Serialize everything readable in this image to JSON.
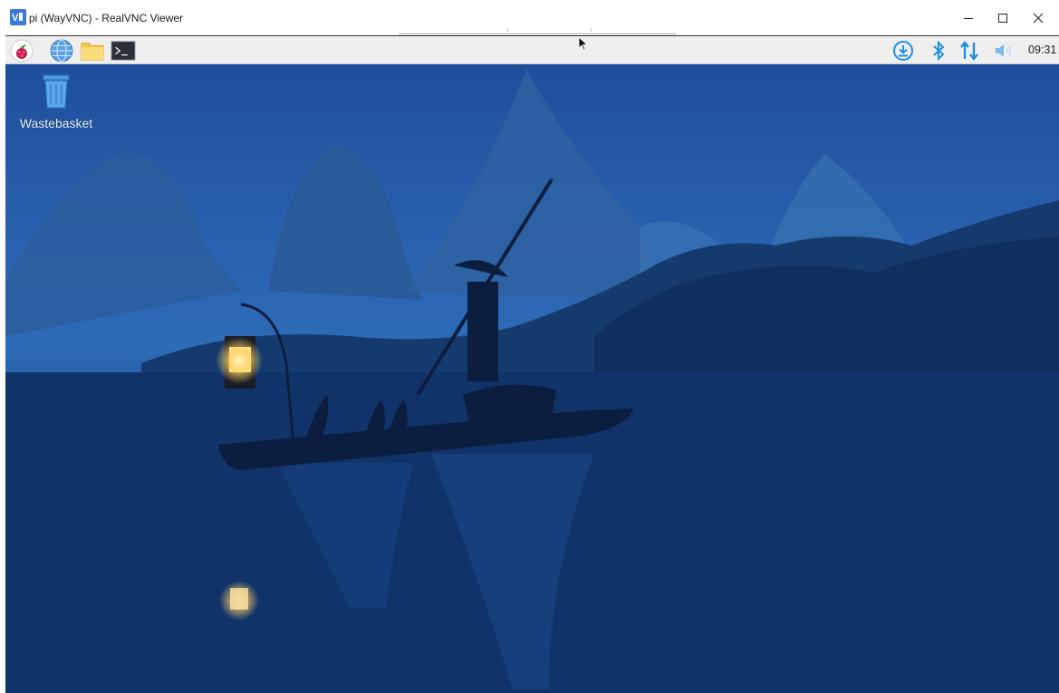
{
  "window": {
    "title": "pi (WayVNC) - RealVNC Viewer",
    "app_icon": "realvnc-icon",
    "controls": [
      "minimize-icon",
      "maximize-icon",
      "close-icon"
    ]
  },
  "panel": {
    "launchers": [
      "raspberry-menu-icon",
      "web-browser-icon",
      "file-manager-icon",
      "terminal-icon"
    ],
    "tray": [
      "updates-download-icon",
      "bluetooth-icon",
      "network-arrows-icon",
      "volume-icon"
    ],
    "clock": "09:31"
  },
  "desktop": {
    "icons": [
      {
        "label": "Wastebasket",
        "icon": "wastebasket-icon"
      }
    ]
  },
  "colors": {
    "panel_bg": "#efefef",
    "tray_blue": "#1e90e8",
    "wallpaper_sky": "#1c4f9a",
    "wallpaper_water": "#0c2a5c"
  }
}
